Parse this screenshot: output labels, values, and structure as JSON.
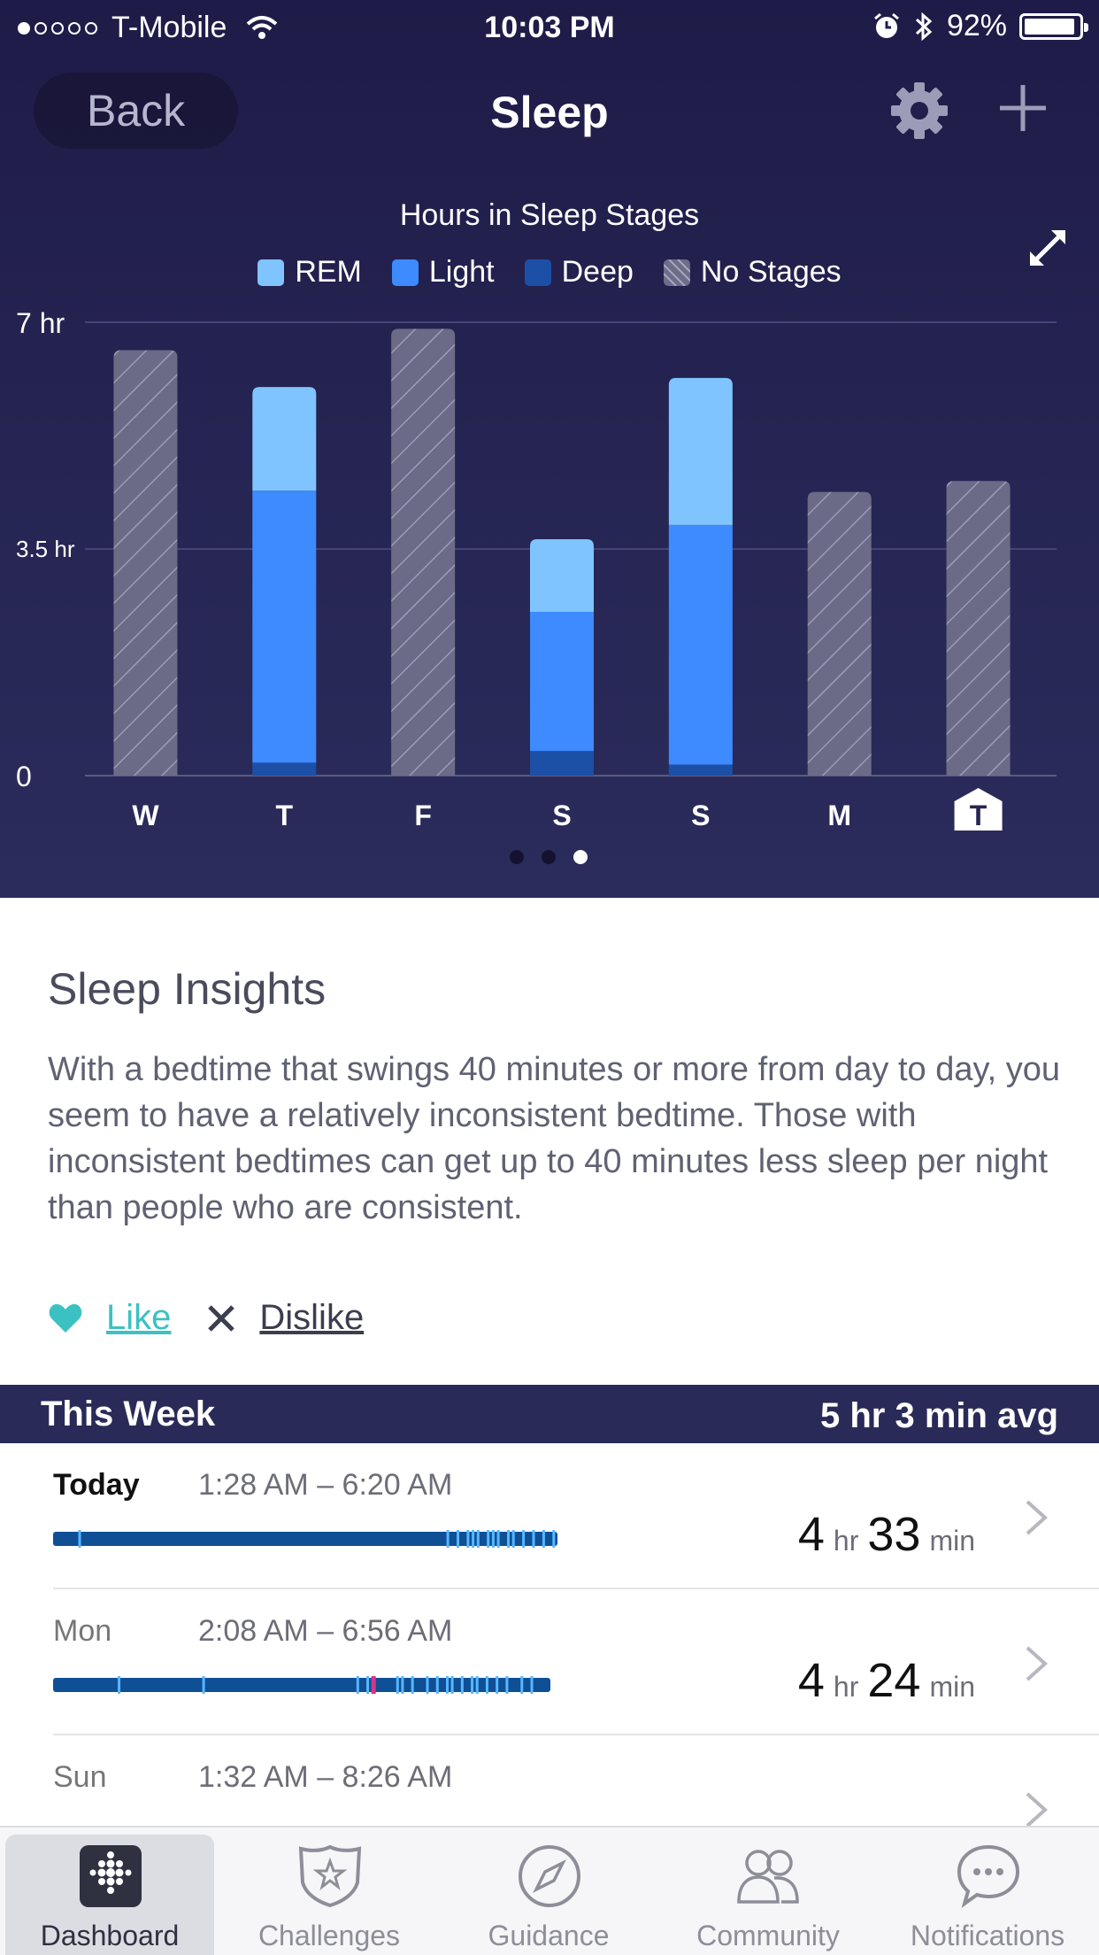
{
  "status_bar": {
    "carrier": "T-Mobile",
    "time": "10:03 PM",
    "battery": "92%",
    "battery_level": 0.92
  },
  "nav": {
    "back_label": "Back",
    "title": "Sleep"
  },
  "chart_data": {
    "type": "bar",
    "title": "Hours in Sleep Stages",
    "stacked": true,
    "categories": [
      "W",
      "T",
      "F",
      "S",
      "S",
      "M",
      "T"
    ],
    "selected_category_index": 6,
    "y_ticks": [
      "0",
      "3.5 hr",
      "7 hr"
    ],
    "ylim": [
      0,
      7
    ],
    "legend_position": "top-center",
    "series": [
      {
        "name": "Deep",
        "color": "#1c4fa6",
        "values": [
          0,
          0.2,
          0,
          0.38,
          0.17,
          0,
          0
        ]
      },
      {
        "name": "Light",
        "color": "#3d8bff",
        "values": [
          0,
          4.2,
          0,
          2.15,
          3.7,
          0,
          0
        ]
      },
      {
        "name": "REM",
        "color": "#7fc4ff",
        "values": [
          0,
          1.6,
          0,
          1.12,
          2.27,
          0,
          0
        ]
      },
      {
        "name": "No Stages",
        "color": "#6d6d8a",
        "values": [
          6.57,
          0,
          6.9,
          0,
          0,
          4.38,
          4.55
        ]
      }
    ],
    "pager": {
      "count": 3,
      "active": 2
    }
  },
  "insights": {
    "title": "Sleep Insights",
    "body": "With a bedtime that swings 40 minutes or more from day to day, you seem to have a relatively inconsistent bedtime. Those with inconsistent bedtimes can get up to 40 minutes less sleep per night than people who are consistent.",
    "like_label": "Like",
    "dislike_label": "Dislike"
  },
  "week": {
    "title": "This Week",
    "average": "5 hr 3 min avg",
    "rows": [
      {
        "day": "Today",
        "range": "1:28 AM – 6:20 AM",
        "hours": "4",
        "hr_unit": "hr",
        "minutes": "33",
        "min_unit": "min",
        "awake_marks": [
          0.05,
          0.78,
          0.8,
          0.82,
          0.83,
          0.84,
          0.86,
          0.87,
          0.88,
          0.9,
          0.91,
          0.93,
          0.95,
          0.97,
          0.99
        ],
        "restless_marks": []
      },
      {
        "day": "Mon",
        "range": "2:08 AM – 6:56 AM",
        "hours": "4",
        "hr_unit": "hr",
        "minutes": "24",
        "min_unit": "min",
        "awake_marks": [
          0.13,
          0.3,
          0.61,
          0.63,
          0.69,
          0.7,
          0.72,
          0.75,
          0.77,
          0.79,
          0.8,
          0.82,
          0.84,
          0.85,
          0.87,
          0.89,
          0.91,
          0.94,
          0.96
        ],
        "restless_marks": [
          0.64
        ]
      },
      {
        "day": "Sun",
        "range": "1:32 AM – 8:26 AM"
      }
    ]
  },
  "tabs": [
    {
      "label": "Dashboard",
      "icon": "dashboard-icon",
      "active": true
    },
    {
      "label": "Challenges",
      "icon": "challenges-badge-icon",
      "active": false
    },
    {
      "label": "Guidance",
      "icon": "compass-icon",
      "active": false
    },
    {
      "label": "Community",
      "icon": "community-people-icon",
      "active": false
    },
    {
      "label": "Notifications",
      "icon": "chat-bubble-icon",
      "active": false
    }
  ],
  "colors": {
    "header_bg": "#211d4a",
    "accent_teal": "#3cc1c2",
    "week_header_bg": "#2a2a58",
    "sleep_bar": "#0f4f96",
    "awake_mark": "#56b8ff",
    "restless_mark": "#d6368a"
  }
}
